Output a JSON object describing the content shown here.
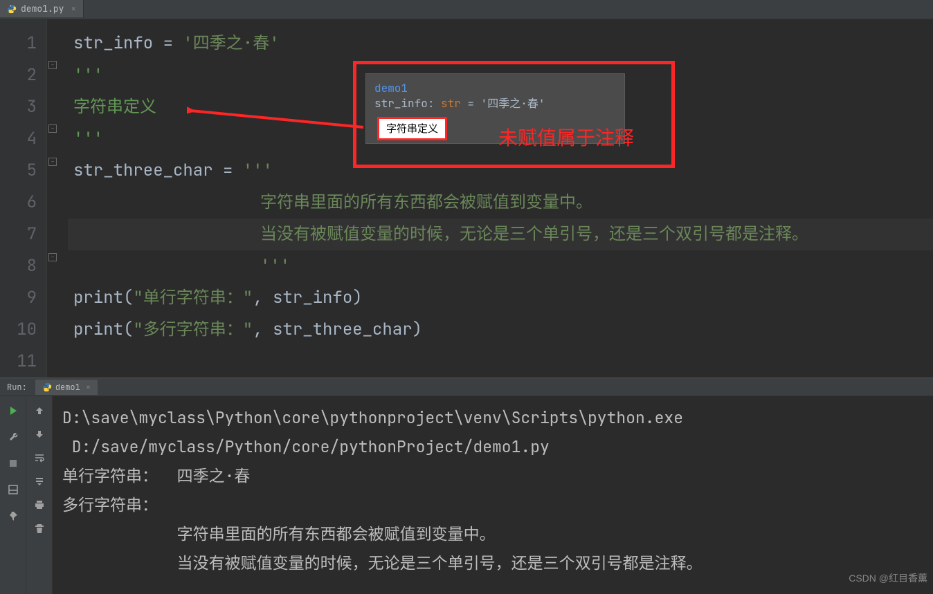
{
  "tab": {
    "filename": "demo1.py",
    "close_glyph": "×"
  },
  "gutter": [
    "1",
    "2",
    "3",
    "4",
    "5",
    "6",
    "7",
    "8",
    "9",
    "10",
    "11"
  ],
  "code": {
    "l1_var": "str_info",
    "l1_op": " = ",
    "l1_str": "'四季之·春'",
    "l2": "'''",
    "l3": "字符串定义",
    "l4": "'''",
    "l5_var": "str_three_char",
    "l5_op": " = ",
    "l5_str": "'''",
    "l6": "字符串里面的所有东西都会被赋值到变量中。",
    "l7": "当没有被赋值变量的时候，无论是三个单引号，还是三个双引号都是注释。",
    "l8": "'''",
    "l9_fn": "print",
    "l9_args_a": "\"单行字符串：\"",
    "l9_args_b": "str_info",
    "l10_fn": "print",
    "l10_args_a": "\"多行字符串：\"",
    "l10_args_b": "str_three_char"
  },
  "hint": {
    "module": "demo1",
    "var": "str_info",
    "sep": ": ",
    "type": "str",
    "eq": " = ",
    "value": "'四季之·春'",
    "doc": "字符串定义"
  },
  "annotation_text": "未赋值属于注释",
  "run": {
    "label": "Run:",
    "tabname": "demo1",
    "close_glyph": "×",
    "out1": "D:\\save\\myclass\\Python\\core\\pythonproject\\venv\\Scripts\\python.exe",
    "out2": " D:/save/myclass/Python/core/pythonProject/demo1.py",
    "out3": "单行字符串：  四季之·春",
    "out4": "多行字符串：  ",
    "out5": "            字符串里面的所有东西都会被赋值到变量中。",
    "out6": "            当没有被赋值变量的时候，无论是三个单引号，还是三个双引号都是注释。"
  },
  "watermark": "CSDN @红目香薰"
}
